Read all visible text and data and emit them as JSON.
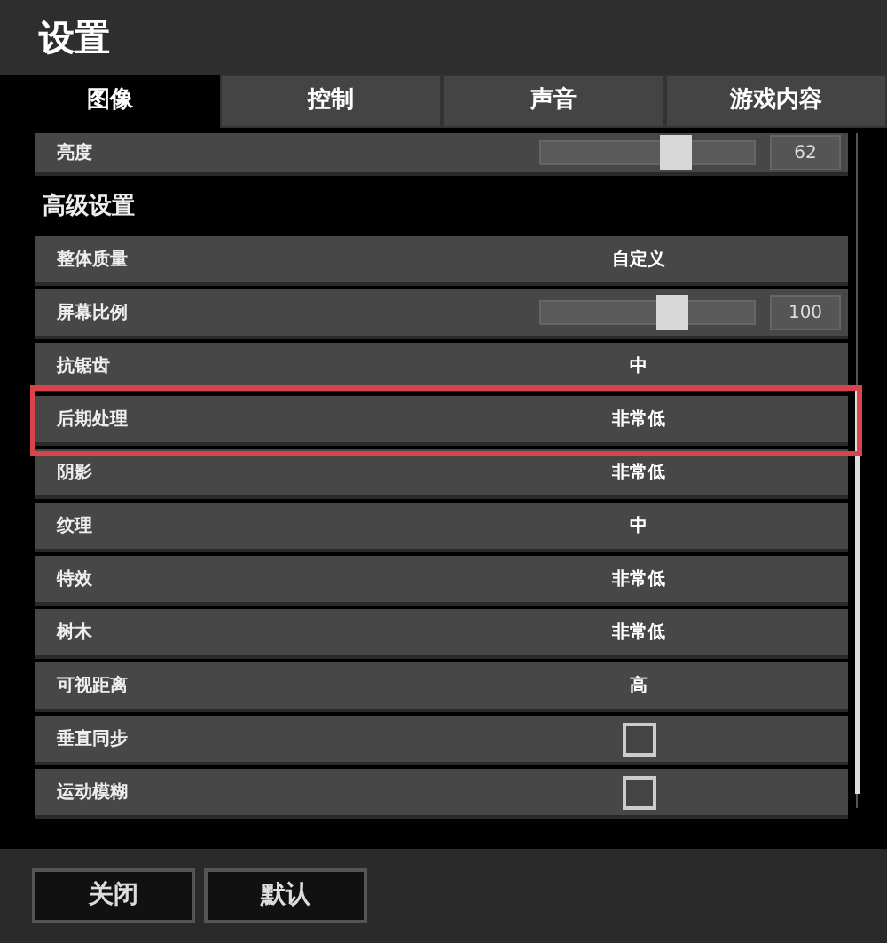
{
  "window": {
    "title": "设置"
  },
  "tabs": [
    {
      "label": "图像",
      "selected": true
    },
    {
      "label": "控制",
      "selected": false
    },
    {
      "label": "声音",
      "selected": false
    },
    {
      "label": "游戏内容",
      "selected": false
    }
  ],
  "top_row": {
    "kind": "slider",
    "label": "亮度",
    "level": 0.63,
    "reading": "62"
  },
  "section": {
    "title": "高级设置"
  },
  "rows": [
    {
      "kind": "choice",
      "label": "整体质量",
      "value": "自定义",
      "highlighted": false
    },
    {
      "kind": "slider",
      "label": "屏幕比例",
      "level": 0.62,
      "reading": "100",
      "highlighted": false
    },
    {
      "kind": "choice",
      "label": "抗锯齿",
      "value": "中",
      "highlighted": false
    },
    {
      "kind": "choice",
      "label": "后期处理",
      "value": "非常低",
      "highlighted": true
    },
    {
      "kind": "choice",
      "label": "阴影",
      "value": "非常低",
      "highlighted": false
    },
    {
      "kind": "choice",
      "label": "纹理",
      "value": "中",
      "highlighted": false
    },
    {
      "kind": "choice",
      "label": "特效",
      "value": "非常低",
      "highlighted": false
    },
    {
      "kind": "choice",
      "label": "树木",
      "value": "非常低",
      "highlighted": false
    },
    {
      "kind": "choice",
      "label": "可视距离",
      "value": "高",
      "highlighted": false
    },
    {
      "kind": "checkbox",
      "label": "垂直同步",
      "checked": false,
      "highlighted": false
    },
    {
      "kind": "checkbox",
      "label": "运动模糊",
      "checked": false,
      "highlighted": false
    }
  ],
  "buttons": [
    "关闭",
    "默认"
  ]
}
